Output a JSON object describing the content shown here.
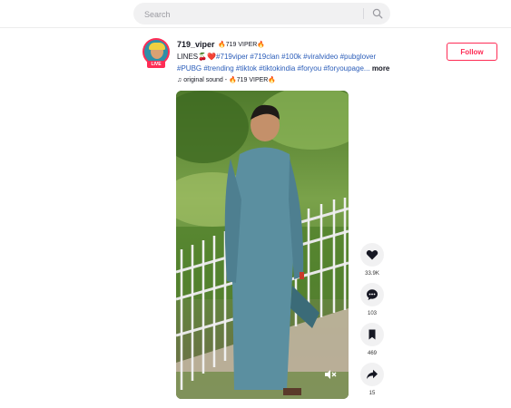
{
  "search": {
    "placeholder": "Search",
    "icon": "search-icon"
  },
  "post": {
    "username": "719_viper",
    "nickname": "🔥719 VIPER🔥",
    "live_badge": "LIVE",
    "caption_line1_plain": "LINES🍒❤️",
    "caption_line1_tags": "#719viper #719clan #100k #viralvideo #pubglover",
    "caption_line2_tags": "#PUBG #trending #tiktok #tiktokindia #foryou #foryoupage...",
    "more_label": "more",
    "sound_label": "♫ original sound - 🔥719 VIPER🔥",
    "follow_label": "Follow"
  },
  "actions": [
    {
      "name": "like",
      "icon": "heart-icon",
      "count": "33.9K"
    },
    {
      "name": "comment",
      "icon": "comment-icon",
      "count": "103"
    },
    {
      "name": "save",
      "icon": "bookmark-icon",
      "count": "469"
    },
    {
      "name": "share",
      "icon": "share-icon",
      "count": "15"
    }
  ],
  "colors": {
    "accent": "#fe2c55",
    "hashtag": "#2b5db9",
    "chip": "#f1f1f2"
  }
}
